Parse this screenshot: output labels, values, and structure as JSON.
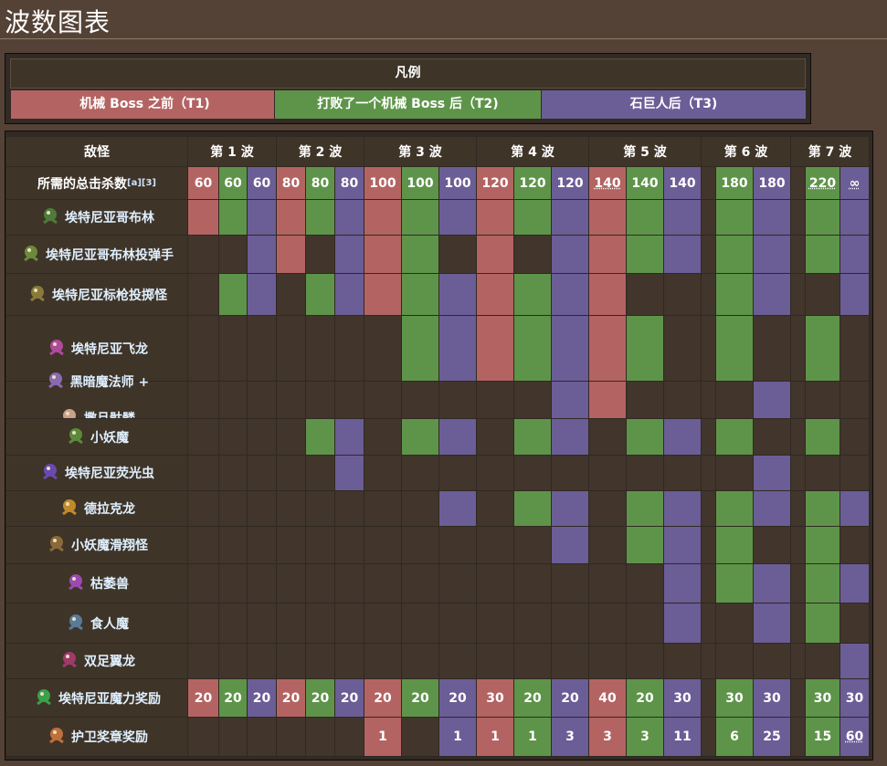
{
  "page": {
    "title": "波数图表"
  },
  "legend": {
    "heading": "凡例",
    "tiers": [
      {
        "label": "机械 Boss 之前（T1)",
        "color": "#b36462"
      },
      {
        "label": "打败了一个机械 Boss 后（T2)",
        "color": "#5e9449"
      },
      {
        "label": "石巨人后（T3)",
        "color": "#6b5d96"
      }
    ]
  },
  "table": {
    "header_enemy": "敌怪",
    "waves": [
      "第 1 波",
      "第 2 波",
      "第 3 波",
      "第 4 波",
      "第 5 波",
      "第 6 波",
      "第 7 波"
    ],
    "kills_label": "所需的总击杀数",
    "kills_refs": "[a][3]",
    "column_tiers": [
      "t1",
      "t2",
      "t3",
      "t1",
      "t2",
      "t3",
      "t1",
      "t2",
      "t3",
      "t1",
      "t2",
      "t3",
      "t1",
      "t2",
      "t3",
      "gap",
      "t2",
      "t3",
      "gap",
      "t2",
      "t3"
    ],
    "kills": [
      "60",
      "60",
      "60",
      "80",
      "80",
      "80",
      "100",
      "100",
      "100",
      "120",
      "120",
      "120",
      "140",
      "140",
      "140",
      "",
      "180",
      "180",
      "",
      "220",
      "∞"
    ],
    "enemies": [
      {
        "name": "埃特尼亚哥布林",
        "icon": "etherian-goblin-icon",
        "cells": [
          1,
          1,
          1,
          1,
          1,
          1,
          1,
          1,
          1,
          1,
          1,
          1,
          1,
          1,
          1,
          0,
          1,
          1,
          0,
          1,
          1
        ]
      },
      {
        "name": "埃特尼亚哥布林投弹手",
        "icon": "etherian-goblin-bomber-icon",
        "cells": [
          0,
          0,
          1,
          1,
          0,
          1,
          1,
          1,
          0,
          1,
          0,
          1,
          1,
          1,
          1,
          0,
          1,
          1,
          0,
          1,
          1
        ]
      },
      {
        "name": "埃特尼亚标枪投掷怪",
        "icon": "etherian-javelin-thrower-icon",
        "cells": [
          0,
          1,
          1,
          0,
          1,
          1,
          1,
          1,
          1,
          1,
          1,
          1,
          1,
          0,
          0,
          0,
          1,
          1,
          0,
          0,
          1
        ]
      },
      {
        "name": "埃特尼亚飞龙",
        "icon": "etherian-wyvern-icon",
        "cells": [
          0,
          0,
          0,
          0,
          0,
          0,
          0,
          1,
          1,
          1,
          1,
          1,
          1,
          1,
          0,
          0,
          1,
          0,
          0,
          1,
          0
        ]
      },
      {
        "name": "黑暗魔法师 +",
        "name2": "撒旦骷髅",
        "icon": "dark-mage-icon",
        "icon2": "old-ones-skeleton-icon",
        "tall": true,
        "cells": [
          0,
          0,
          0,
          0,
          0,
          0,
          0,
          0,
          0,
          0,
          0,
          1,
          1,
          0,
          0,
          0,
          0,
          1,
          0,
          0,
          0
        ]
      },
      {
        "name": "小妖魔",
        "icon": "kobold-icon",
        "cells": [
          0,
          0,
          0,
          0,
          1,
          1,
          0,
          1,
          1,
          0,
          1,
          1,
          0,
          1,
          1,
          0,
          1,
          0,
          0,
          1,
          0
        ]
      },
      {
        "name": "埃特尼亚荧光虫",
        "icon": "etherian-lightning-bug-icon",
        "cells": [
          0,
          0,
          0,
          0,
          0,
          1,
          0,
          0,
          0,
          0,
          0,
          0,
          0,
          0,
          0,
          0,
          0,
          1,
          0,
          0,
          0
        ]
      },
      {
        "name": "德拉克龙",
        "icon": "drakin-icon",
        "cells": [
          0,
          0,
          0,
          0,
          0,
          0,
          0,
          0,
          1,
          0,
          1,
          1,
          0,
          1,
          1,
          0,
          1,
          1,
          0,
          1,
          1
        ]
      },
      {
        "name": "小妖魔滑翔怪",
        "icon": "kobold-glider-icon",
        "cells": [
          0,
          0,
          0,
          0,
          0,
          0,
          0,
          0,
          0,
          0,
          0,
          1,
          0,
          1,
          1,
          0,
          1,
          0,
          0,
          1,
          0
        ]
      },
      {
        "name": "枯萎兽",
        "icon": "withered-beast-icon",
        "cells": [
          0,
          0,
          0,
          0,
          0,
          0,
          0,
          0,
          0,
          0,
          0,
          0,
          0,
          0,
          1,
          0,
          1,
          1,
          0,
          1,
          1
        ]
      },
      {
        "name": "食人魔",
        "icon": "ogre-icon",
        "cells": [
          0,
          0,
          0,
          0,
          0,
          0,
          0,
          0,
          0,
          0,
          0,
          0,
          0,
          0,
          1,
          0,
          0,
          1,
          0,
          1,
          0
        ]
      },
      {
        "name": "双足翼龙",
        "icon": "betsy-icon",
        "cells": [
          0,
          0,
          0,
          0,
          0,
          0,
          0,
          0,
          0,
          0,
          0,
          0,
          0,
          0,
          0,
          0,
          0,
          0,
          0,
          0,
          1
        ]
      }
    ],
    "mana_reward": {
      "label": "埃特尼亚魔力奖励",
      "icon": "etherian-mana-icon",
      "values": [
        "20",
        "20",
        "20",
        "20",
        "20",
        "20",
        "20",
        "20",
        "20",
        "30",
        "20",
        "20",
        "40",
        "20",
        "30",
        "",
        "30",
        "30",
        "",
        "30",
        "30"
      ]
    },
    "medal_reward": {
      "label": "护卫奖章奖励",
      "icon": "defender-medal-icon",
      "values": [
        "",
        "",
        "",
        "",
        "",
        "",
        "1",
        "",
        "1",
        "1",
        "1",
        "3",
        "3",
        "3",
        "11",
        "",
        "6",
        "25",
        "",
        "15",
        "60"
      ]
    }
  }
}
